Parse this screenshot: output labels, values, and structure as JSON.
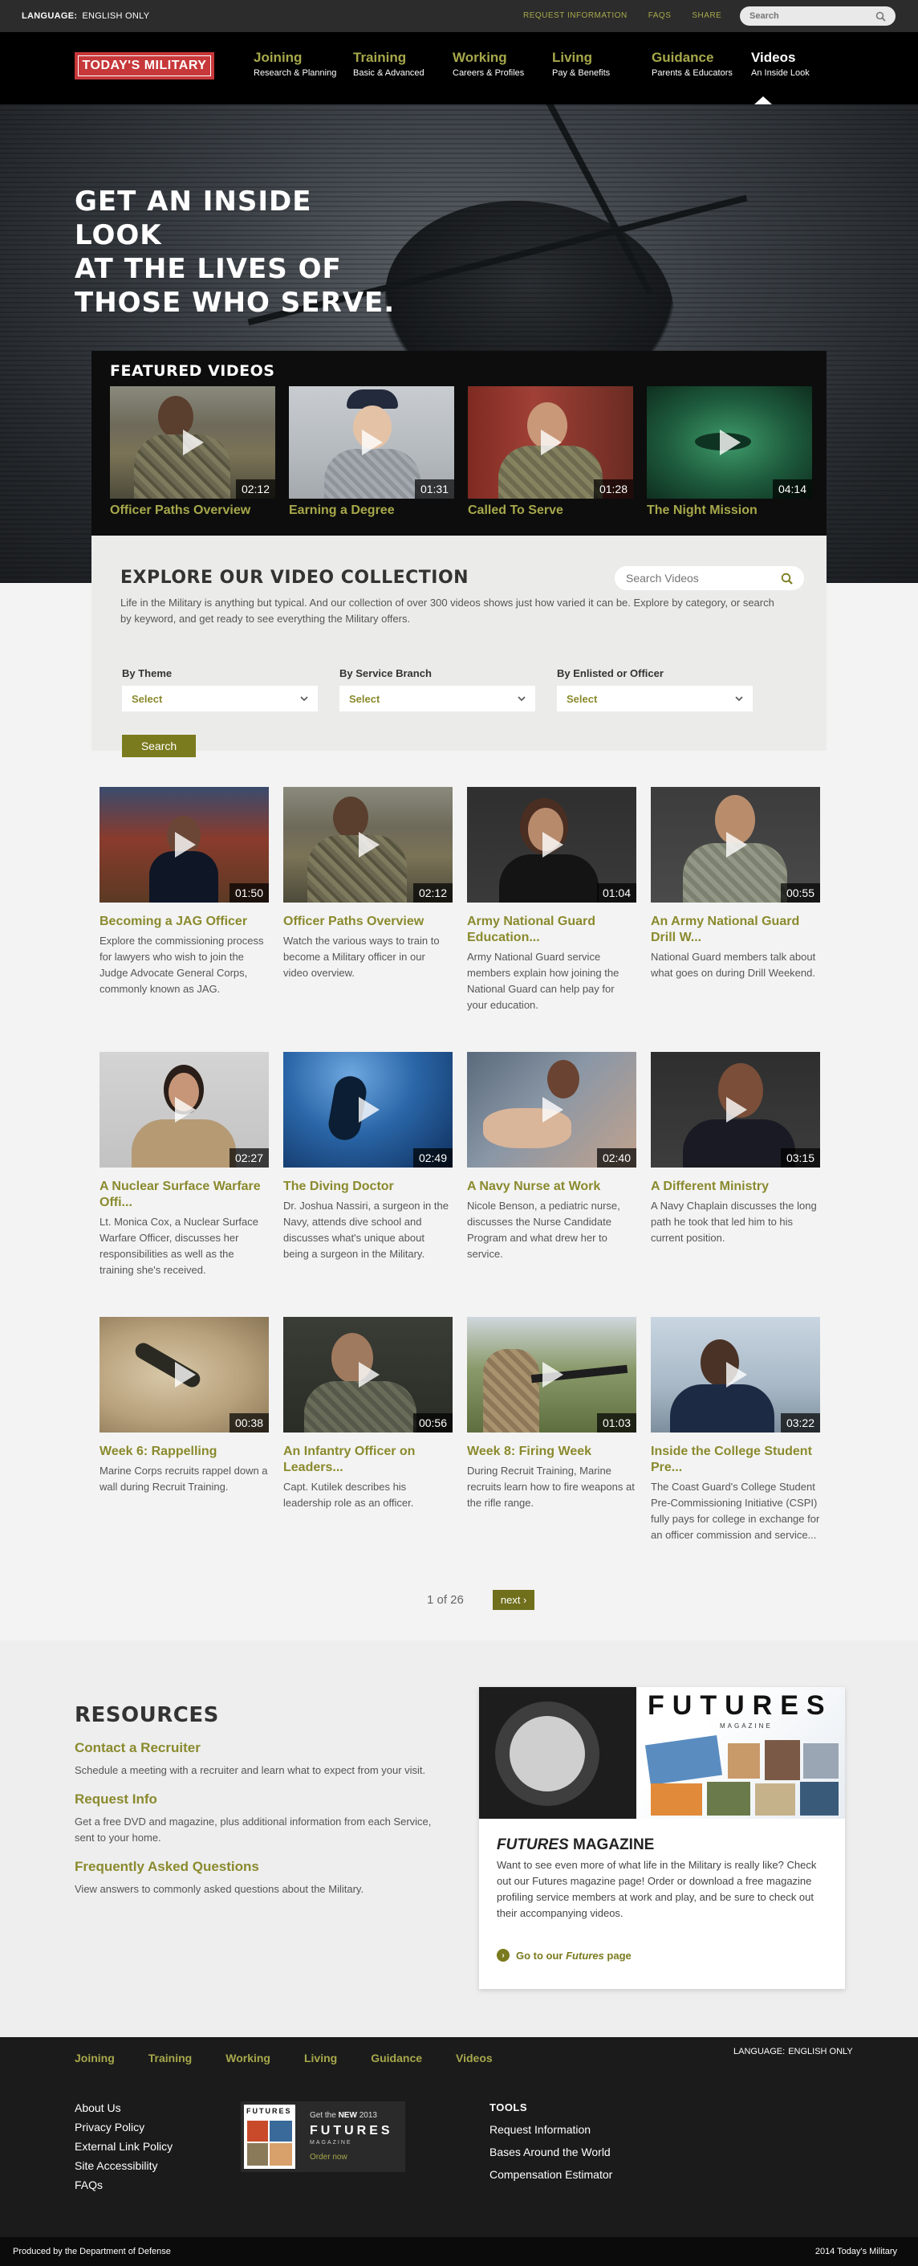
{
  "utility": {
    "language_label": "LANGUAGE:",
    "language_value": "ENGLISH ONLY",
    "links": [
      "REQUEST INFORMATION",
      "FAQS",
      "SHARE"
    ],
    "search_placeholder": "Search"
  },
  "header": {
    "logo_text": "TODAY'S MILITARY",
    "nav": [
      {
        "title": "Joining",
        "subtitle": "Research & Planning"
      },
      {
        "title": "Training",
        "subtitle": "Basic & Advanced"
      },
      {
        "title": "Working",
        "subtitle": "Careers & Profiles"
      },
      {
        "title": "Living",
        "subtitle": "Pay & Benefits"
      },
      {
        "title": "Guidance",
        "subtitle": "Parents & Educators"
      },
      {
        "title": "Videos",
        "subtitle": "An Inside Look"
      }
    ]
  },
  "hero": {
    "headline_1": "GET AN INSIDE LOOK",
    "headline_2": "AT THE LIVES OF",
    "headline_3": "THOSE WHO SERVE."
  },
  "featured": {
    "title": "FEATURED VIDEOS",
    "items": [
      {
        "caption": "Officer Paths Overview",
        "duration": "02:12"
      },
      {
        "caption": "Earning a Degree",
        "duration": "01:31"
      },
      {
        "caption": "Called To Serve",
        "duration": "01:28"
      },
      {
        "caption": "The Night Mission",
        "duration": "04:14"
      }
    ]
  },
  "explore": {
    "title": "EXPLORE OUR VIDEO COLLECTION",
    "search_placeholder": "Search Videos",
    "description": "Life in the Military is anything but typical. And our collection of over 300 videos shows just how varied it can be. Explore by category, or search by keyword, and get ready to see everything the Military offers.",
    "filters": [
      {
        "label": "By Theme",
        "value": "Select"
      },
      {
        "label": "By Service Branch",
        "value": "Select"
      },
      {
        "label": "By Enlisted or Officer",
        "value": "Select"
      }
    ],
    "button": "Search"
  },
  "videos": [
    {
      "title": "Becoming a JAG Officer",
      "duration": "01:50",
      "desc": "Explore the commissioning process for lawyers who wish to join the Judge Advocate General Corps, commonly known as JAG."
    },
    {
      "title": "Officer Paths Overview",
      "duration": "02:12",
      "desc": "Watch the various ways to train to become a Military officer in our video overview."
    },
    {
      "title": "Army National Guard Education...",
      "duration": "01:04",
      "desc": "Army National Guard service members explain how joining the National Guard can help pay for your education."
    },
    {
      "title": "An Army National Guard Drill W...",
      "duration": "00:55",
      "desc": "National Guard members talk about what goes on during Drill Weekend."
    },
    {
      "title": "A Nuclear Surface Warfare Offi...",
      "duration": "02:27",
      "desc": "Lt. Monica Cox, a Nuclear Surface Warfare Officer, discusses her responsibilities as well as the training she's received."
    },
    {
      "title": "The Diving Doctor",
      "duration": "02:49",
      "desc": "Dr. Joshua Nassiri, a surgeon in the Navy, attends dive school and discusses what's unique about being a surgeon in the Military."
    },
    {
      "title": "A Navy Nurse at Work",
      "duration": "02:40",
      "desc": "Nicole Benson, a pediatric nurse, discusses the Nurse Candidate Program and what drew her to service."
    },
    {
      "title": "A Different Ministry",
      "duration": "03:15",
      "desc": "A Navy Chaplain discusses the long path he took that led him to his current position."
    },
    {
      "title": "Week 6: Rappelling",
      "duration": "00:38",
      "desc": "Marine Corps recruits rappel down a wall during Recruit Training."
    },
    {
      "title": "An Infantry Officer on Leaders...",
      "duration": "00:56",
      "desc": "Capt. Kutilek describes his leadership role as an officer."
    },
    {
      "title": "Week 8: Firing Week",
      "duration": "01:03",
      "desc": "During Recruit Training, Marine recruits learn how to fire weapons at the rifle range."
    },
    {
      "title": "Inside the College Student Pre...",
      "duration": "03:22",
      "desc": "The Coast Guard's College Student Pre-Commissioning Initiative (CSPI) fully pays for college in exchange for an officer commission and service..."
    }
  ],
  "pager": {
    "status": "1 of 26",
    "next": "next ›"
  },
  "resources": {
    "title": "RESOURCES",
    "items": [
      {
        "title": "Contact a Recruiter",
        "desc": "Schedule a meeting with a recruiter and learn what to expect from your visit."
      },
      {
        "title": "Request Info",
        "desc": "Get a free DVD and magazine, plus additional information from each Service, sent to your home."
      },
      {
        "title": "Frequently Asked Questions",
        "desc": "View answers to commonly asked questions about the Military."
      }
    ]
  },
  "futures": {
    "logo": "FUTURES",
    "logo_sub": "MAGAZINE",
    "heading_italic": "FUTURES",
    "heading_rest": " MAGAZINE",
    "body": "Want to see even more of what life in the Military is really like? Check out our Futures magazine page! Order or download a free magazine profiling service members at work and play, and be sure to check out their accompanying videos.",
    "link_prefix": "Go to our ",
    "link_italic": "Futures",
    "link_suffix": " page"
  },
  "footer": {
    "nav": [
      "Joining",
      "Training",
      "Working",
      "Living",
      "Guidance",
      "Videos"
    ],
    "language_label": "LANGUAGE:",
    "language_value": "ENGLISH ONLY",
    "links": [
      "About Us",
      "Privacy Policy",
      "External Link Policy",
      "Site Accessibility",
      "FAQs"
    ],
    "promo_line_pre": "Get the ",
    "promo_line_bold": "NEW",
    "promo_line_post": " 2013",
    "promo_logo": "FUTURES",
    "promo_sub": "MAGAZINE",
    "promo_cta": "Order now",
    "tools_title": "TOOLS",
    "tools": [
      "Request Information",
      "Bases Around the World",
      "Compensation Estimator"
    ],
    "produced_by": "Produced by the Department of Defense",
    "copyright": "2014 Today's Military"
  }
}
